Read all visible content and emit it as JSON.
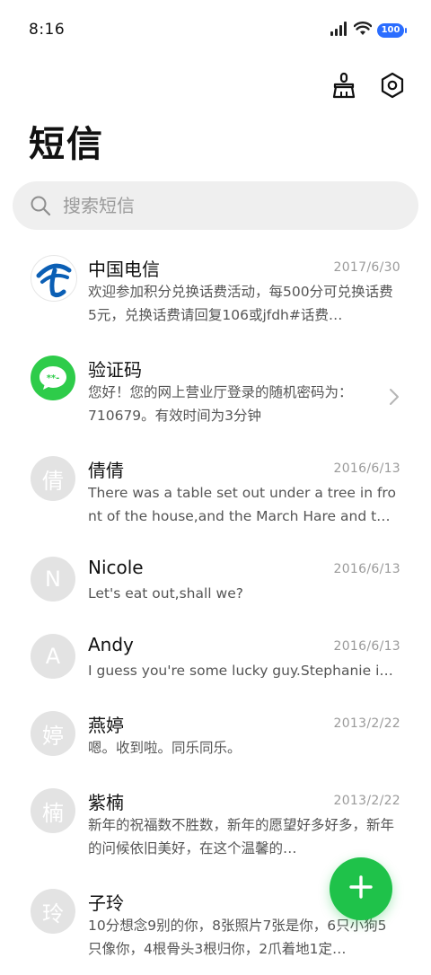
{
  "status_bar": {
    "time": "8:16",
    "battery_level": "100",
    "icons": [
      "signal-icon",
      "wifi-icon",
      "battery-icon"
    ]
  },
  "header": {
    "title": "短信",
    "actions": [
      "broom-icon",
      "settings-icon"
    ]
  },
  "search": {
    "placeholder": "搜索短信"
  },
  "messages": [
    {
      "sender": "中国电信",
      "date": "2017/6/30",
      "preview": "欢迎参加积分兑换话费活动，每500分可兑换话费5元，兑换话费请回复106或jfdh#话费…",
      "avatar": "telecom-logo-icon"
    },
    {
      "sender": "验证码",
      "date": "",
      "preview": "您好！您的网上营业厅登录的随机密码为：710679。有效时间为3分钟",
      "avatar": "chat-bubble-icon"
    },
    {
      "sender": "倩倩",
      "date": "2016/6/13",
      "preview": "There was a table set out under a tree in front of the house,and the March Hare and the Hatter were havi…",
      "avatar_letter": "倩"
    },
    {
      "sender": "Nicole",
      "date": "2016/6/13",
      "preview": "Let's eat out,shall we?",
      "avatar_letter": "N"
    },
    {
      "sender": "Andy",
      "date": "2016/6/13",
      "preview": "I guess you're some lucky guy.Stephanie is a nice girl.",
      "avatar_letter": "A"
    },
    {
      "sender": "燕婷",
      "date": "2013/2/22",
      "preview": "嗯。收到啦。同乐同乐。",
      "avatar_letter": "婷"
    },
    {
      "sender": "紫楠",
      "date": "2013/2/22",
      "preview": "新年的祝福数不胜数，新年的愿望好多好多，新年的问候依旧美好，在这个温馨的…",
      "avatar_letter": "楠"
    },
    {
      "sender": "子玲",
      "date": "",
      "preview": "10分想念9别的你，8张照片7张是你，6只小狗5只像你，4根骨头3根归你，2爪着地1定…",
      "avatar_letter": "玲"
    }
  ],
  "fab": {
    "icon": "plus-icon"
  },
  "colors": {
    "accent_green": "#1fc24a",
    "battery_blue": "#2b6dff",
    "telecom_blue": "#0b5fb5",
    "avatar_gray": "#e3e3e3"
  }
}
